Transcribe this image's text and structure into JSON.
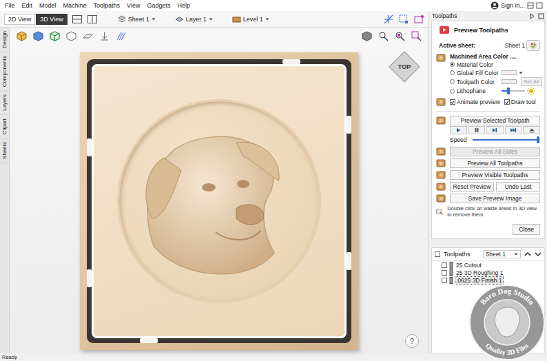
{
  "menu": [
    "File",
    "Edit",
    "Model",
    "Machine",
    "Toolpaths",
    "View",
    "Gadgets",
    "Help"
  ],
  "account": "Sign in...",
  "view_tabs": [
    {
      "label": "2D View",
      "selected": false
    },
    {
      "label": "3D View",
      "selected": true
    }
  ],
  "selectors": [
    {
      "label": "Sheet 1",
      "kind": "sheet"
    },
    {
      "label": "Layer 1",
      "kind": "layer"
    },
    {
      "label": "Level 1",
      "kind": "level"
    }
  ],
  "side_tabs": [
    "Design",
    "Components",
    "Layers",
    "Clipart",
    "Sheets"
  ],
  "view_cube": "TOP",
  "help": "?",
  "panel": {
    "title": "Toolpaths",
    "heading": "Preview Toolpaths",
    "active_sheet_label": "Active sheet:",
    "active_sheet": "Sheet 1",
    "color_label": "Machined Area Color ....",
    "color_options": [
      {
        "label": "Material Color",
        "selected": true,
        "kind": "plain"
      },
      {
        "label": "Global Fill Color",
        "selected": false,
        "kind": "swatch"
      },
      {
        "label": "Toolpath Color",
        "selected": false,
        "kind": "swatch"
      },
      {
        "label": "Lithophane",
        "selected": false,
        "kind": "slider",
        "level": 0.3
      }
    ],
    "set_all": {
      "label": "Set All",
      "disabled": true
    },
    "checks": [
      {
        "label": "Animate preview",
        "checked": true
      },
      {
        "label": "Draw tool",
        "checked": true
      }
    ],
    "preview_selected": "Preview Selected Toolpath",
    "speed": {
      "label": "Speed",
      "level": 0.97
    },
    "actions": [
      [
        {
          "label": "Preview All Sides",
          "disabled": true
        }
      ],
      [
        {
          "label": "Preview All Toolpaths",
          "disabled": false
        }
      ],
      [
        {
          "label": "Preview Visible Toolpaths",
          "disabled": false
        }
      ],
      [
        {
          "label": "Reset Preview",
          "disabled": false
        },
        {
          "label": "Undo Last",
          "disabled": false
        }
      ],
      [
        {
          "label": "Save Preview Image",
          "disabled": false
        }
      ]
    ],
    "hint": "Double click on waste areas in 3D view to remove them.",
    "close": "Close"
  },
  "toolpaths": {
    "title": "Toolpaths",
    "header_checked": false,
    "sheet": "Sheet 1",
    "items": [
      {
        "name": "25 Cutout",
        "checked": false,
        "selected": false
      },
      {
        "name": "25 3D Roughing 1",
        "checked": false,
        "selected": false
      },
      {
        "name": ".0625 3D Finish 1",
        "checked": false,
        "selected": true
      }
    ]
  },
  "watermark": {
    "top": "Barn Dog Studio",
    "bottom": "Quality 3D Files"
  },
  "status": "Ready"
}
